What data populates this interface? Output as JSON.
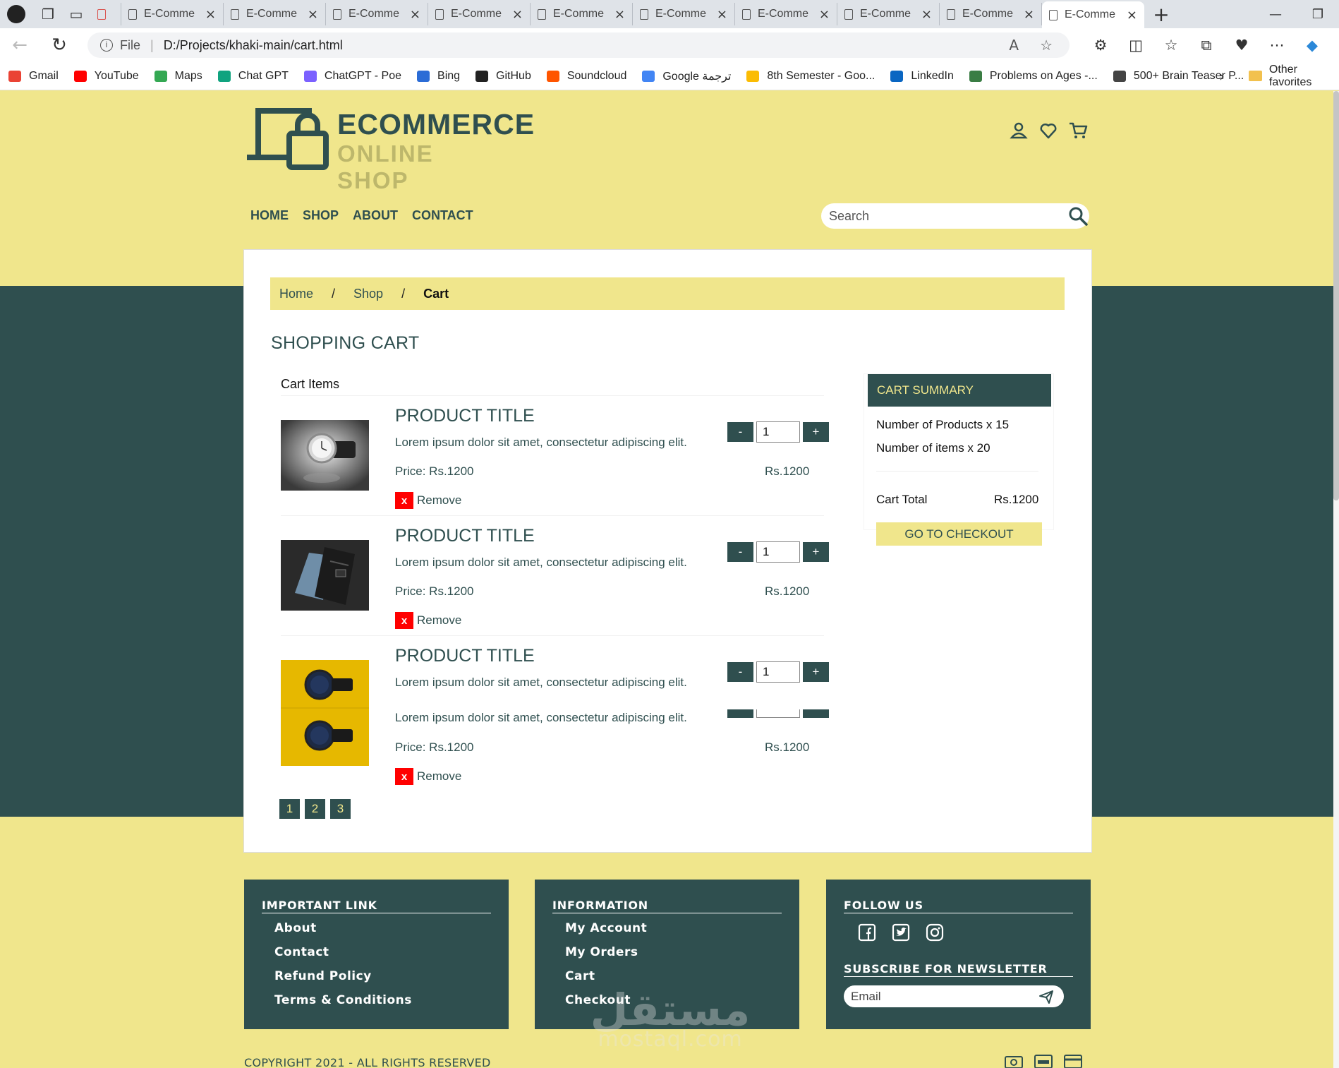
{
  "browser": {
    "tabs": [
      {
        "label": "",
        "kind": "pdf"
      },
      {
        "label": "E-Comme",
        "kind": "doc"
      },
      {
        "label": "E-Comme",
        "kind": "doc"
      },
      {
        "label": "E-Comme",
        "kind": "doc"
      },
      {
        "label": "E-Comme",
        "kind": "doc"
      },
      {
        "label": "E-Comme",
        "kind": "doc"
      },
      {
        "label": "E-Comme",
        "kind": "doc"
      },
      {
        "label": "E-Comme",
        "kind": "doc"
      },
      {
        "label": "E-Comme",
        "kind": "doc"
      },
      {
        "label": "E-Comme",
        "kind": "doc"
      },
      {
        "label": "E-Comme",
        "kind": "doc",
        "active": true
      }
    ],
    "address": {
      "scheme_label": "File",
      "url": "D:/Projects/khaki-main/cart.html"
    },
    "favorites": [
      {
        "label": "Gmail",
        "color": "#ea4335"
      },
      {
        "label": "YouTube",
        "color": "#ff0000"
      },
      {
        "label": "Maps",
        "color": "#34a853"
      },
      {
        "label": "Chat GPT",
        "color": "#10a37f"
      },
      {
        "label": "ChatGPT - Poe",
        "color": "#7b61ff"
      },
      {
        "label": "Bing",
        "color": "#2b6cd6"
      },
      {
        "label": "GitHub",
        "color": "#222222"
      },
      {
        "label": "Soundcloud",
        "color": "#ff5500"
      },
      {
        "label": "Google ترجمة",
        "color": "#4285f4"
      },
      {
        "label": "8th Semester - Goo...",
        "color": "#fbbc04"
      },
      {
        "label": "LinkedIn",
        "color": "#0a66c2"
      },
      {
        "label": "Problems on Ages -...",
        "color": "#3a7d44"
      },
      {
        "label": "500+ Brain Teaser P...",
        "color": "#444444"
      }
    ],
    "other_favorites": "Other favorites"
  },
  "site": {
    "logo_line1": "ECOMMERCE",
    "logo_line2": "ONLINE SHOP",
    "nav": [
      "HOME",
      "SHOP",
      "ABOUT",
      "CONTACT"
    ],
    "search_placeholder": "Search",
    "colors": {
      "primary": "#2f4f4f",
      "khaki": "#f0e68c",
      "dark_khaki": "#bdb76b",
      "remove": "#ff0000"
    }
  },
  "breadcrumb": {
    "home": "Home",
    "sep": "/",
    "shop": "Shop",
    "current": "Cart"
  },
  "cart": {
    "heading": "SHOPPING CART",
    "items_label": "Cart Items",
    "items": [
      {
        "title": "PRODUCT TITLE",
        "desc": "Lorem ipsum dolor sit amet, consectetur adipiscing elit.",
        "price": "Price: Rs.1200",
        "total": "Rs.1200",
        "qty": "1",
        "remove": "Remove",
        "x": "x",
        "minus": "-",
        "plus": "+",
        "image": "silver-watch"
      },
      {
        "title": "PRODUCT TITLE",
        "desc": "Lorem ipsum dolor sit amet, consectetur adipiscing elit.",
        "price": "Price: Rs.1200",
        "total": "Rs.1200",
        "qty": "1",
        "remove": "Remove",
        "x": "x",
        "minus": "-",
        "plus": "+",
        "image": "jeans"
      },
      {
        "title": "PRODUCT TITLE",
        "desc": "Lorem ipsum dolor sit amet, consectetur adipiscing elit.",
        "price": "Price: Rs.1200",
        "total": "Rs.1200",
        "qty": "1",
        "remove": "Remove",
        "x": "x",
        "minus": "-",
        "plus": "+",
        "image": "blue-watch",
        "overlap_desc": "Lorem ipsum dolor sit amet, consectetur adipiscing elit."
      }
    ],
    "pages": [
      "1",
      "2",
      "3"
    ]
  },
  "summary": {
    "heading": "CART SUMMARY",
    "products": "Number of Products x 15",
    "items": "Number of items x 20",
    "total_label": "Cart Total",
    "total_value": "Rs.1200",
    "checkout": "GO TO CHECKOUT"
  },
  "footer": {
    "important": {
      "heading": "IMPORTANT LINK",
      "links": [
        "About",
        "Contact",
        "Refund Policy",
        "Terms & Conditions"
      ]
    },
    "information": {
      "heading": "INFORMATION",
      "links": [
        "My Account",
        "My Orders",
        "Cart",
        "Checkout"
      ]
    },
    "follow": {
      "heading": "FOLLOW US",
      "icons": [
        "facebook-icon",
        "twitter-icon",
        "instagram-icon"
      ],
      "newsletter": "SUBSCRIBE FOR NEWSLETTER",
      "email_placeholder": "Email"
    },
    "copyright": "COPYRIGHT 2021 - ALL RIGHTS RESERVED",
    "payment_icons": [
      "cash-icon",
      "visa-icon",
      "card-icon"
    ]
  },
  "watermark": {
    "arabic": "مستقل",
    "latin": "mostaql.com"
  }
}
